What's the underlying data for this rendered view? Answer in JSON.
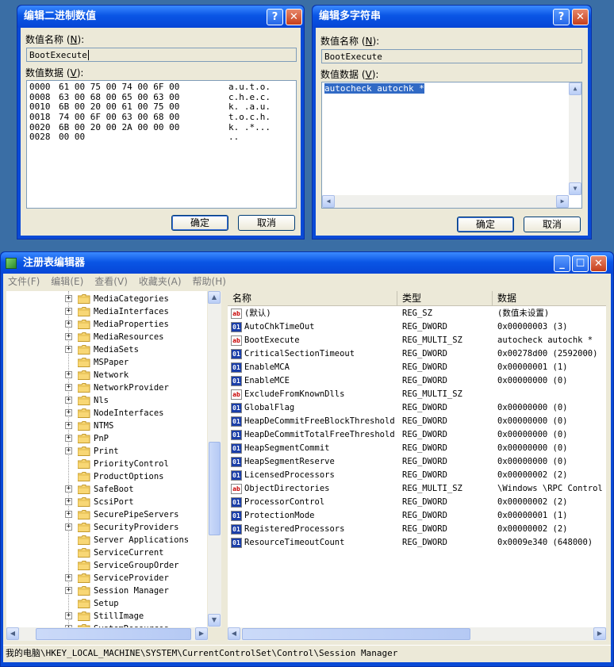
{
  "binary_dialog": {
    "title": "编辑二进制数值",
    "name_label": "数值名称",
    "name_key": "N",
    "name_value": "BootExecute",
    "data_label": "数值数据",
    "data_key": "V",
    "hex_rows": [
      {
        "offset": "0000",
        "bytes": "61 00 75 00 74 00 6F 00",
        "ascii": "a.u.t.o."
      },
      {
        "offset": "0008",
        "bytes": "63 00 68 00 65 00 63 00",
        "ascii": "c.h.e.c."
      },
      {
        "offset": "0010",
        "bytes": "6B 00 20 00 61 00 75 00",
        "ascii": "k. .a.u."
      },
      {
        "offset": "0018",
        "bytes": "74 00 6F 00 63 00 68 00",
        "ascii": "t.o.c.h."
      },
      {
        "offset": "0020",
        "bytes": "6B 00 20 00 2A 00 00 00",
        "ascii": "k. .*..."
      },
      {
        "offset": "0028",
        "bytes": "00 00",
        "ascii": ".."
      }
    ],
    "ok": "确定",
    "cancel": "取消"
  },
  "multi_dialog": {
    "title": "编辑多字符串",
    "name_label": "数值名称",
    "name_key": "N",
    "name_value": "BootExecute",
    "data_label": "数值数据",
    "data_key": "V",
    "data_value": "autocheck autochk *",
    "ok": "确定",
    "cancel": "取消"
  },
  "regedit": {
    "title": "注册表编辑器",
    "menu": [
      {
        "label": "文件",
        "key": "F"
      },
      {
        "label": "编辑",
        "key": "E"
      },
      {
        "label": "查看",
        "key": "V"
      },
      {
        "label": "收藏夹",
        "key": "A"
      },
      {
        "label": "帮助",
        "key": "H"
      }
    ],
    "tree": [
      {
        "label": "MediaCategories",
        "expandable": true
      },
      {
        "label": "MediaInterfaces",
        "expandable": true
      },
      {
        "label": "MediaProperties",
        "expandable": true
      },
      {
        "label": "MediaResources",
        "expandable": true
      },
      {
        "label": "MediaSets",
        "expandable": true
      },
      {
        "label": "MSPaper",
        "expandable": false
      },
      {
        "label": "Network",
        "expandable": true
      },
      {
        "label": "NetworkProvider",
        "expandable": true
      },
      {
        "label": "Nls",
        "expandable": true
      },
      {
        "label": "NodeInterfaces",
        "expandable": true
      },
      {
        "label": "NTMS",
        "expandable": true
      },
      {
        "label": "PnP",
        "expandable": true
      },
      {
        "label": "Print",
        "expandable": true
      },
      {
        "label": "PriorityControl",
        "expandable": false
      },
      {
        "label": "ProductOptions",
        "expandable": false
      },
      {
        "label": "SafeBoot",
        "expandable": true
      },
      {
        "label": "ScsiPort",
        "expandable": true
      },
      {
        "label": "SecurePipeServers",
        "expandable": true
      },
      {
        "label": "SecurityProviders",
        "expandable": true
      },
      {
        "label": "Server Applications",
        "expandable": false
      },
      {
        "label": "ServiceCurrent",
        "expandable": false
      },
      {
        "label": "ServiceGroupOrder",
        "expandable": false
      },
      {
        "label": "ServiceProvider",
        "expandable": true
      },
      {
        "label": "Session Manager",
        "expandable": true,
        "open": true
      },
      {
        "label": "Setup",
        "expandable": false
      },
      {
        "label": "StillImage",
        "expandable": true
      },
      {
        "label": "SystemResources",
        "expandable": true
      }
    ],
    "columns": {
      "name": "名称",
      "type": "类型",
      "data": "数据"
    },
    "values": [
      {
        "name": "(默认)",
        "type": "REG_SZ",
        "data": "(数值未设置)",
        "icon": "sz"
      },
      {
        "name": "AutoChkTimeOut",
        "type": "REG_DWORD",
        "data": "0x00000003 (3)",
        "icon": "bin"
      },
      {
        "name": "BootExecute",
        "type": "REG_MULTI_SZ",
        "data": "autocheck autochk *",
        "icon": "sz"
      },
      {
        "name": "CriticalSectionTimeout",
        "type": "REG_DWORD",
        "data": "0x00278d00 (2592000)",
        "icon": "bin"
      },
      {
        "name": "EnableMCA",
        "type": "REG_DWORD",
        "data": "0x00000001 (1)",
        "icon": "bin"
      },
      {
        "name": "EnableMCE",
        "type": "REG_DWORD",
        "data": "0x00000000 (0)",
        "icon": "bin"
      },
      {
        "name": "ExcludeFromKnownDlls",
        "type": "REG_MULTI_SZ",
        "data": "",
        "icon": "sz"
      },
      {
        "name": "GlobalFlag",
        "type": "REG_DWORD",
        "data": "0x00000000 (0)",
        "icon": "bin"
      },
      {
        "name": "HeapDeCommitFreeBlockThreshold",
        "type": "REG_DWORD",
        "data": "0x00000000 (0)",
        "icon": "bin"
      },
      {
        "name": "HeapDeCommitTotalFreeThreshold",
        "type": "REG_DWORD",
        "data": "0x00000000 (0)",
        "icon": "bin"
      },
      {
        "name": "HeapSegmentCommit",
        "type": "REG_DWORD",
        "data": "0x00000000 (0)",
        "icon": "bin"
      },
      {
        "name": "HeapSegmentReserve",
        "type": "REG_DWORD",
        "data": "0x00000000 (0)",
        "icon": "bin"
      },
      {
        "name": "LicensedProcessors",
        "type": "REG_DWORD",
        "data": "0x00000002 (2)",
        "icon": "bin"
      },
      {
        "name": "ObjectDirectories",
        "type": "REG_MULTI_SZ",
        "data": "\\Windows \\RPC Control",
        "icon": "sz"
      },
      {
        "name": "ProcessorControl",
        "type": "REG_DWORD",
        "data": "0x00000002 (2)",
        "icon": "bin"
      },
      {
        "name": "ProtectionMode",
        "type": "REG_DWORD",
        "data": "0x00000001 (1)",
        "icon": "bin"
      },
      {
        "name": "RegisteredProcessors",
        "type": "REG_DWORD",
        "data": "0x00000002 (2)",
        "icon": "bin"
      },
      {
        "name": "ResourceTimeoutCount",
        "type": "REG_DWORD",
        "data": "0x0009e340 (648000)",
        "icon": "bin"
      }
    ],
    "status_path": "我的电脑\\HKEY_LOCAL_MACHINE\\SYSTEM\\CurrentControlSet\\Control\\Session Manager",
    "icons": {
      "sz": "ab",
      "bin": "01"
    }
  },
  "colors": {
    "desktop": "#3a6ea5",
    "titlebar": "#0a55e5",
    "selection": "#316ac5"
  }
}
